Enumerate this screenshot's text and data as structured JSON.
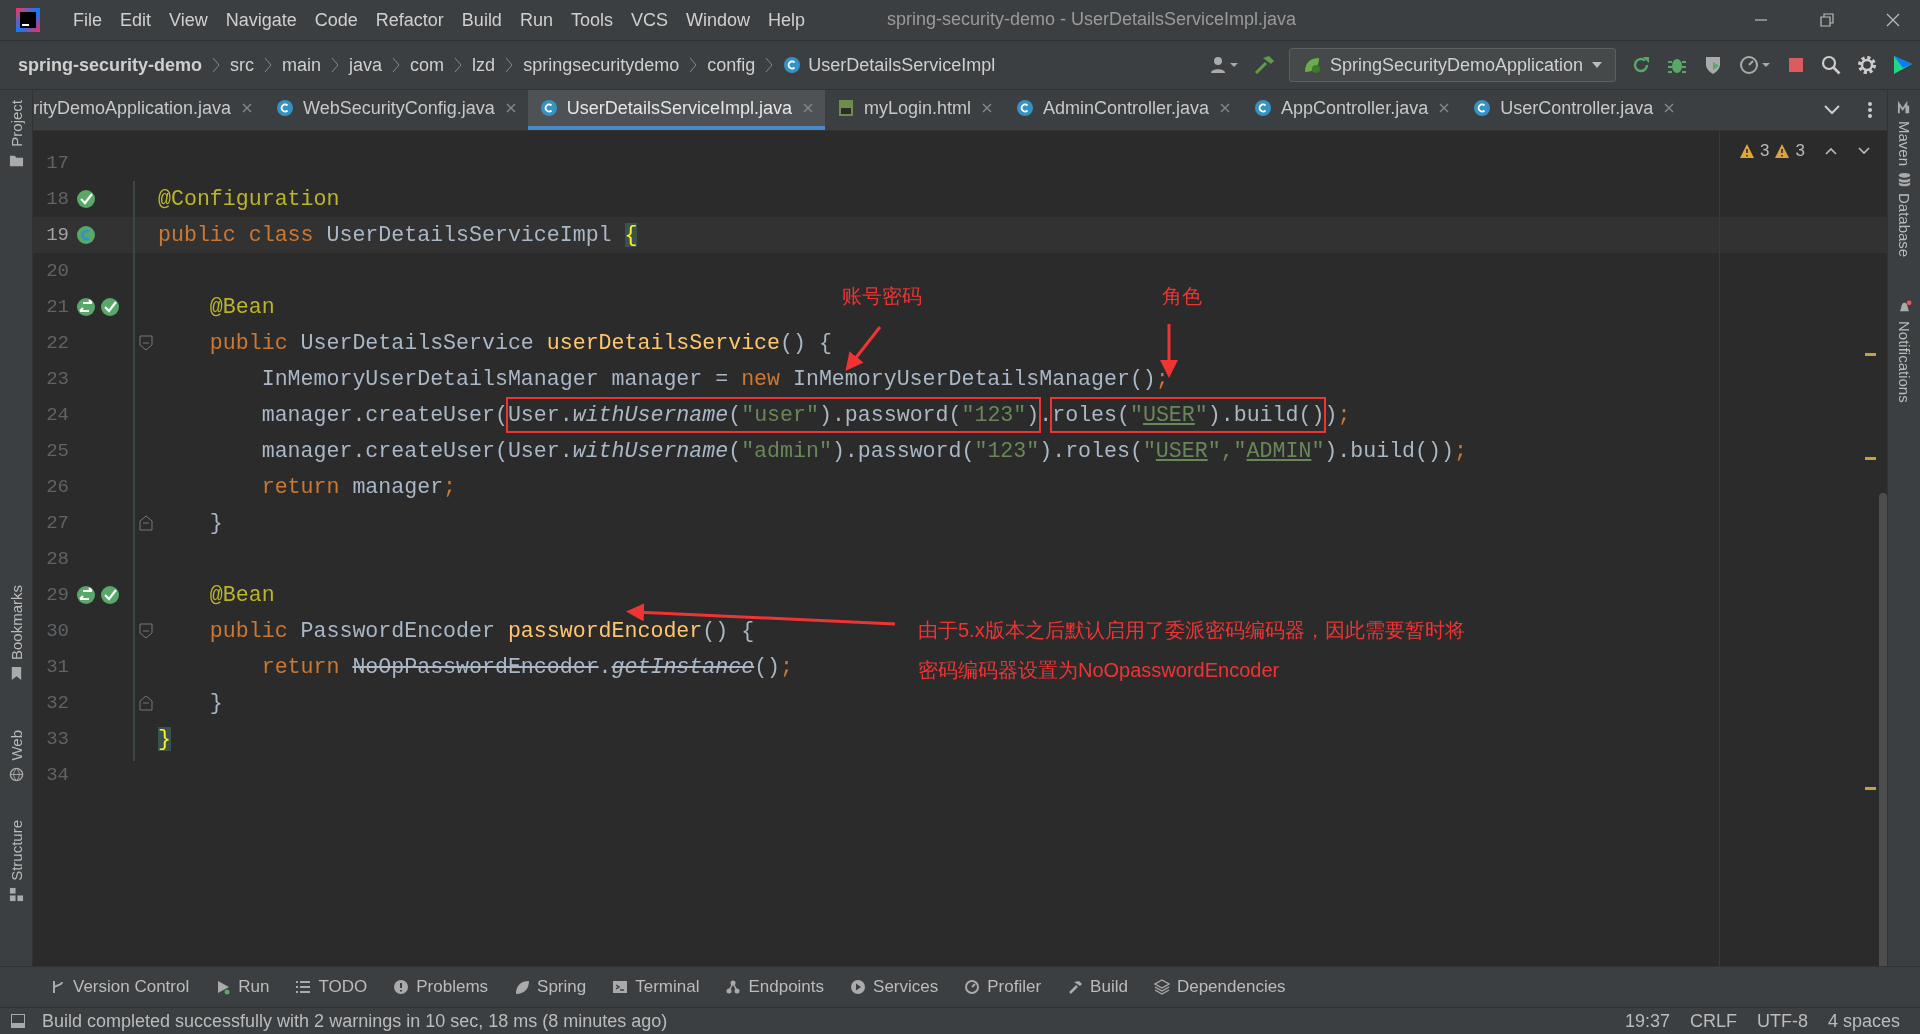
{
  "menu": [
    "File",
    "Edit",
    "View",
    "Navigate",
    "Code",
    "Refactor",
    "Build",
    "Run",
    "Tools",
    "VCS",
    "Window",
    "Help"
  ],
  "window": {
    "title": "spring-security-demo - UserDetailsServiceImpl.java"
  },
  "breadcrumbs": [
    {
      "label": "spring-security-demo",
      "kind": "project"
    },
    {
      "label": "src",
      "kind": "folder"
    },
    {
      "label": "main",
      "kind": "folder"
    },
    {
      "label": "java",
      "kind": "folder"
    },
    {
      "label": "com",
      "kind": "folder"
    },
    {
      "label": "lzd",
      "kind": "folder"
    },
    {
      "label": "springsecuritydemo",
      "kind": "folder"
    },
    {
      "label": "config",
      "kind": "folder"
    },
    {
      "label": "UserDetailsServiceImpl",
      "kind": "class"
    }
  ],
  "run_config": {
    "label": "SpringSecurityDemoApplication"
  },
  "tabs": [
    {
      "label": "rityDemoApplication.java",
      "selected": false
    },
    {
      "label": "WebSecurityConfig.java",
      "selected": false
    },
    {
      "label": "UserDetailsServiceImpl.java",
      "selected": true
    },
    {
      "label": "myLogin.html",
      "selected": false
    },
    {
      "label": "AdminController.java",
      "selected": false
    },
    {
      "label": "AppController.java",
      "selected": false
    },
    {
      "label": "UserController.java",
      "selected": false
    }
  ],
  "left_tools": [
    "Project",
    "Bookmarks",
    "Web",
    "Structure"
  ],
  "right_tools": [
    "Maven",
    "Database",
    "Notifications"
  ],
  "inspections": {
    "warnings": "3",
    "weak_warnings": "3"
  },
  "code": [
    {
      "number": "17",
      "current": false
    },
    {
      "number": "18",
      "current": false,
      "tokens": [
        {
          "kind": "ann",
          "text": "@Configuration"
        }
      ]
    },
    {
      "number": "19",
      "current": true,
      "tokens": [
        {
          "kind": "kw",
          "text": "public class "
        },
        {
          "kind": "plain",
          "text": "UserDetailsServiceImpl "
        },
        {
          "kind": "brace",
          "text": "{"
        }
      ]
    },
    {
      "number": "20",
      "current": false
    },
    {
      "number": "21",
      "current": false,
      "tokens": [
        {
          "kind": "ann",
          "text": "    @Bean"
        }
      ]
    },
    {
      "number": "22",
      "current": false,
      "tokens": [
        {
          "kind": "kw",
          "text": "    public "
        },
        {
          "kind": "plain",
          "text": "UserDetailsService "
        },
        {
          "kind": "fn",
          "text": "userDetailsService"
        },
        {
          "kind": "plain",
          "text": "() {"
        }
      ]
    },
    {
      "number": "23",
      "current": false,
      "tokens": [
        {
          "kind": "plain",
          "text": "        InMemoryUserDetailsManager manager = "
        },
        {
          "kind": "kw",
          "text": "new"
        },
        {
          "kind": "plain",
          "text": " InMemoryUserDetailsManager()"
        },
        {
          "kind": "kw",
          "text": ";"
        }
      ]
    },
    {
      "number": "24",
      "current": false,
      "tokens": [
        {
          "kind": "plain",
          "text": "        manager.createUser("
        },
        {
          "kind": "frame",
          "tokens": [
            {
              "kind": "plain",
              "text": "User."
            },
            {
              "kind": "italic",
              "text": "withUsername"
            },
            {
              "kind": "plain",
              "text": "("
            },
            {
              "kind": "str",
              "text": "\"user\""
            },
            {
              "kind": "plain",
              "text": ").password("
            },
            {
              "kind": "str",
              "text": "\"123\""
            },
            {
              "kind": "plain",
              "text": ")"
            }
          ]
        },
        {
          "kind": "plain",
          "text": "."
        },
        {
          "kind": "frame",
          "tokens": [
            {
              "kind": "plain",
              "text": "roles("
            },
            {
              "kind": "str",
              "text": "\""
            },
            {
              "kind": "str-u",
              "text": "USER"
            },
            {
              "kind": "str",
              "text": "\""
            },
            {
              "kind": "plain",
              "text": ").build()"
            }
          ]
        },
        {
          "kind": "plain",
          "text": ")"
        },
        {
          "kind": "kw",
          "text": ";"
        }
      ]
    },
    {
      "number": "25",
      "current": false,
      "tokens": [
        {
          "kind": "plain",
          "text": "        manager.createUser(User."
        },
        {
          "kind": "italic",
          "text": "withUsername"
        },
        {
          "kind": "plain",
          "text": "("
        },
        {
          "kind": "str",
          "text": "\"admin\""
        },
        {
          "kind": "plain",
          "text": ").password("
        },
        {
          "kind": "str",
          "text": "\"123\""
        },
        {
          "kind": "plain",
          "text": ").roles("
        },
        {
          "kind": "str",
          "text": "\""
        },
        {
          "kind": "str-u",
          "text": "USER"
        },
        {
          "kind": "str",
          "text": "\",\""
        },
        {
          "kind": "str-u",
          "text": "ADMIN"
        },
        {
          "kind": "str",
          "text": "\""
        },
        {
          "kind": "plain",
          "text": ").build())"
        },
        {
          "kind": "kw",
          "text": ";"
        }
      ]
    },
    {
      "number": "26",
      "current": false,
      "tokens": [
        {
          "kind": "kw",
          "text": "        return "
        },
        {
          "kind": "plain",
          "text": "manager"
        },
        {
          "kind": "kw",
          "text": ";"
        }
      ]
    },
    {
      "number": "27",
      "current": false,
      "tokens": [
        {
          "kind": "plain",
          "text": "    }"
        }
      ]
    },
    {
      "number": "28",
      "current": false
    },
    {
      "number": "29",
      "current": false,
      "tokens": [
        {
          "kind": "ann",
          "text": "    @Bean"
        }
      ]
    },
    {
      "number": "30",
      "current": false,
      "tokens": [
        {
          "kind": "kw",
          "text": "    public "
        },
        {
          "kind": "plain",
          "text": "PasswordEncoder "
        },
        {
          "kind": "fn",
          "text": "passwordEncoder"
        },
        {
          "kind": "plain",
          "text": "() {"
        }
      ]
    },
    {
      "number": "31",
      "current": false,
      "tokens": [
        {
          "kind": "kw",
          "text": "        return "
        },
        {
          "kind": "strike",
          "text": "NoOpPasswordEncoder"
        },
        {
          "kind": "plain",
          "text": "."
        },
        {
          "kind": "strike-italic",
          "text": "getInstance"
        },
        {
          "kind": "plain",
          "text": "()"
        },
        {
          "kind": "kw",
          "text": ";"
        }
      ]
    },
    {
      "number": "32",
      "current": false,
      "tokens": [
        {
          "kind": "plain",
          "text": "    }"
        }
      ]
    },
    {
      "number": "33",
      "current": false,
      "tokens": [
        {
          "kind": "brace",
          "text": "}"
        }
      ]
    },
    {
      "number": "34",
      "current": false
    }
  ],
  "callouts": [
    {
      "kind": "label-account",
      "text": "账号密码"
    },
    {
      "kind": "label-role",
      "text": "角色"
    },
    {
      "kind": "note",
      "text": "由于5.x版本之后默认启用了委派密码编码器，因此需要暂时将密码编码器设置为NoOpasswordEncoder"
    }
  ],
  "tool_windows": [
    "Version Control",
    "Run",
    "TODO",
    "Problems",
    "Spring",
    "Terminal",
    "Endpoints",
    "Services",
    "Profiler",
    "Build",
    "Dependencies"
  ],
  "status_bar": {
    "message": "Build completed successfully with 2 warnings in 10 sec, 18 ms (8 minutes ago)",
    "items": [
      "19:37",
      "CRLF",
      "UTF-8",
      "4 spaces"
    ]
  }
}
